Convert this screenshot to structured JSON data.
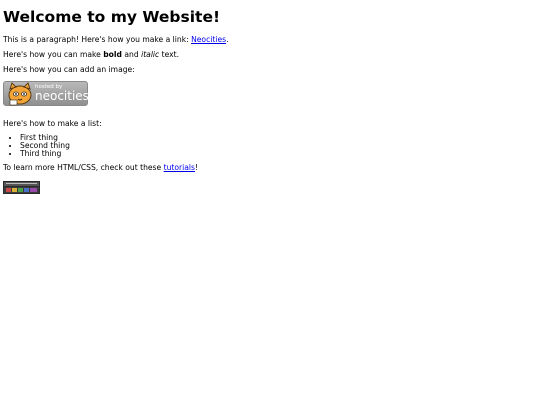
{
  "heading": "Welcome to my Website!",
  "paragraph_link": {
    "before": "This is a paragraph! Here's how you make a link: ",
    "link": "Neocities",
    "after": "."
  },
  "paragraph_bold": {
    "before": "Here's how you can make ",
    "bold": "bold",
    "middle": " and ",
    "italic": "italic",
    "after": " text."
  },
  "paragraph_image": "Here's how you can add an image:",
  "badge": {
    "small_text": "hosted by",
    "big_text": "neocities"
  },
  "paragraph_list": "Here's how to make a list:",
  "list_items": [
    "First thing",
    "Second thing",
    "Third thing"
  ],
  "paragraph_tutorials": {
    "before": "To learn more HTML/CSS, check out these ",
    "link": "tutorials",
    "after": "!"
  },
  "colors": {
    "link": "#0000ee",
    "badge_bg": "#a3a3a3",
    "cat_orange": "#f0a030"
  }
}
